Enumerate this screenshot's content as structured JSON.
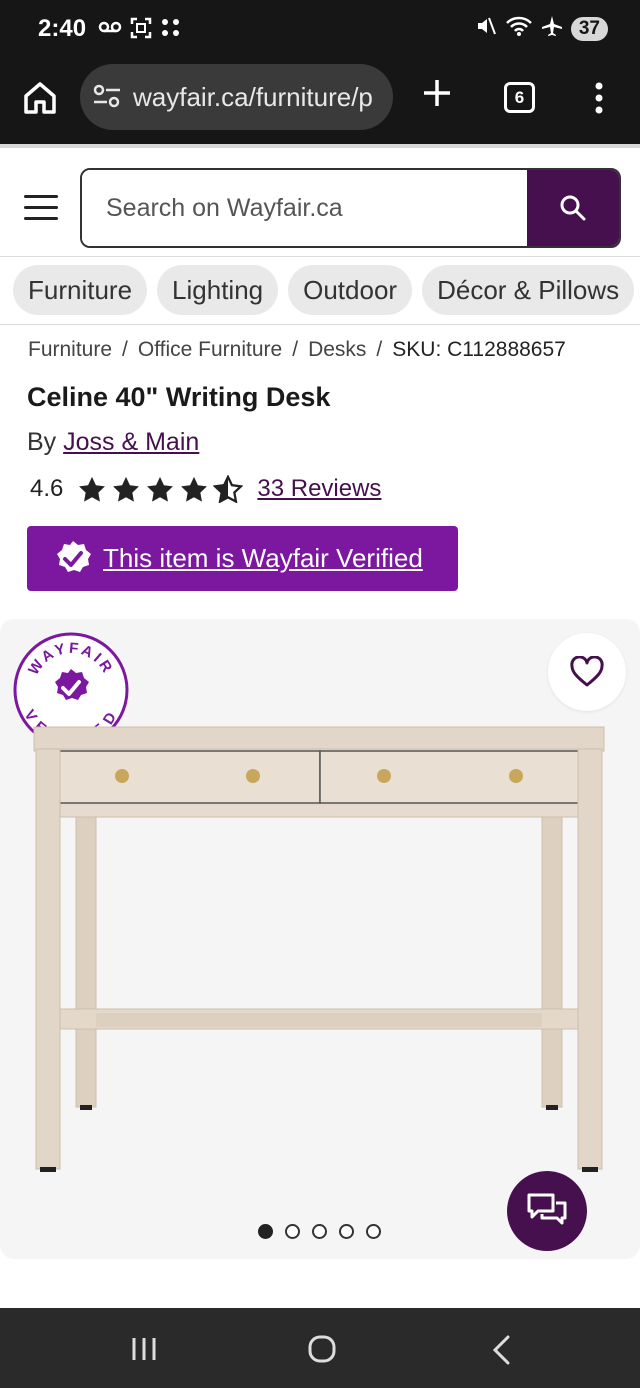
{
  "status_bar": {
    "time": "2:40",
    "battery": "37",
    "left_icons": [
      "voicemail-icon",
      "screenshot-icon",
      "dots-grid-icon"
    ],
    "right_icons": [
      "mute-icon",
      "wifi-icon",
      "airplane-icon",
      "battery-icon"
    ]
  },
  "browser": {
    "url": "wayfair.ca/furniture/p",
    "tab_count": "6"
  },
  "header": {
    "search_placeholder": "Search on Wayfair.ca"
  },
  "categories": [
    "Furniture",
    "Lighting",
    "Outdoor",
    "Décor & Pillows"
  ],
  "breadcrumb": {
    "items": [
      "Furniture",
      "Office Furniture",
      "Desks"
    ],
    "sku": "SKU: C112888657"
  },
  "product": {
    "title": "Celine 40\" Writing Desk",
    "by_prefix": "By",
    "brand": "Joss & Main",
    "rating": "4.6",
    "rating_value": 4.6,
    "reviews_link": "33 Reviews",
    "verified_text": "This item is Wayfair Verified"
  },
  "badge": {
    "top_text": "WAYFAIR",
    "bottom_text": "VERIFIED"
  },
  "gallery": {
    "image_count": 5,
    "active_index": 0
  },
  "colors": {
    "brand_purple": "#46104e",
    "verified_purple": "#7b189f",
    "desk_wood": "#e2d6c8"
  }
}
